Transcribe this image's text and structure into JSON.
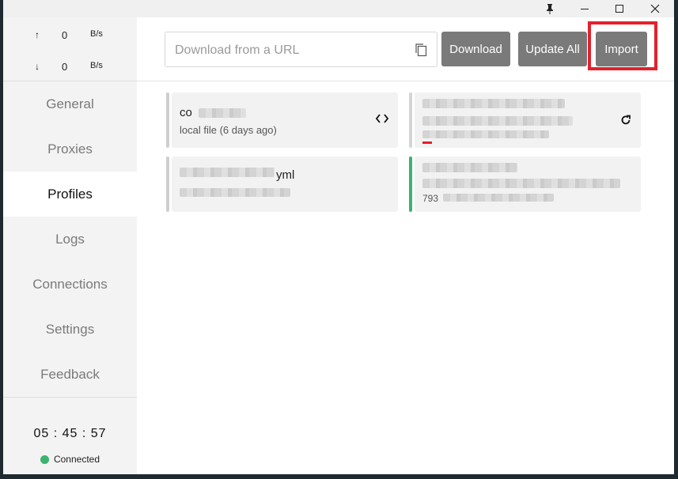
{
  "window": {
    "controls": {
      "pin_icon": "pin-icon",
      "minimize_icon": "minimize-icon",
      "maximize_icon": "maximize-icon",
      "close_icon": "close-icon"
    }
  },
  "traffic": {
    "upload": {
      "arrow": "↑",
      "value": "0",
      "unit": "B/s"
    },
    "download": {
      "arrow": "↓",
      "value": "0",
      "unit": "B/s"
    }
  },
  "nav": {
    "items": [
      {
        "label": "General"
      },
      {
        "label": "Proxies"
      },
      {
        "label": "Profiles"
      },
      {
        "label": "Logs"
      },
      {
        "label": "Connections"
      },
      {
        "label": "Settings"
      },
      {
        "label": "Feedback"
      }
    ],
    "active": "Profiles"
  },
  "clock": "05 : 45 : 57",
  "status": {
    "label": "Connected",
    "color": "#3cb371"
  },
  "toolbar": {
    "url_placeholder": "Download from a URL",
    "download_label": "Download",
    "update_all_label": "Update All",
    "import_label": "Import",
    "button_color": "#7a7a7a",
    "highlight_color": "#e3212c"
  },
  "profiles": [
    {
      "title": "co",
      "subtitle": "local file (6 days ago)",
      "icon": "code-icon"
    },
    {
      "title": "",
      "subtitle": "",
      "icon": "refresh-icon"
    },
    {
      "title": "yml",
      "subtitle": "",
      "icon": ""
    },
    {
      "title": "",
      "subtitle": "793",
      "icon": ""
    }
  ]
}
